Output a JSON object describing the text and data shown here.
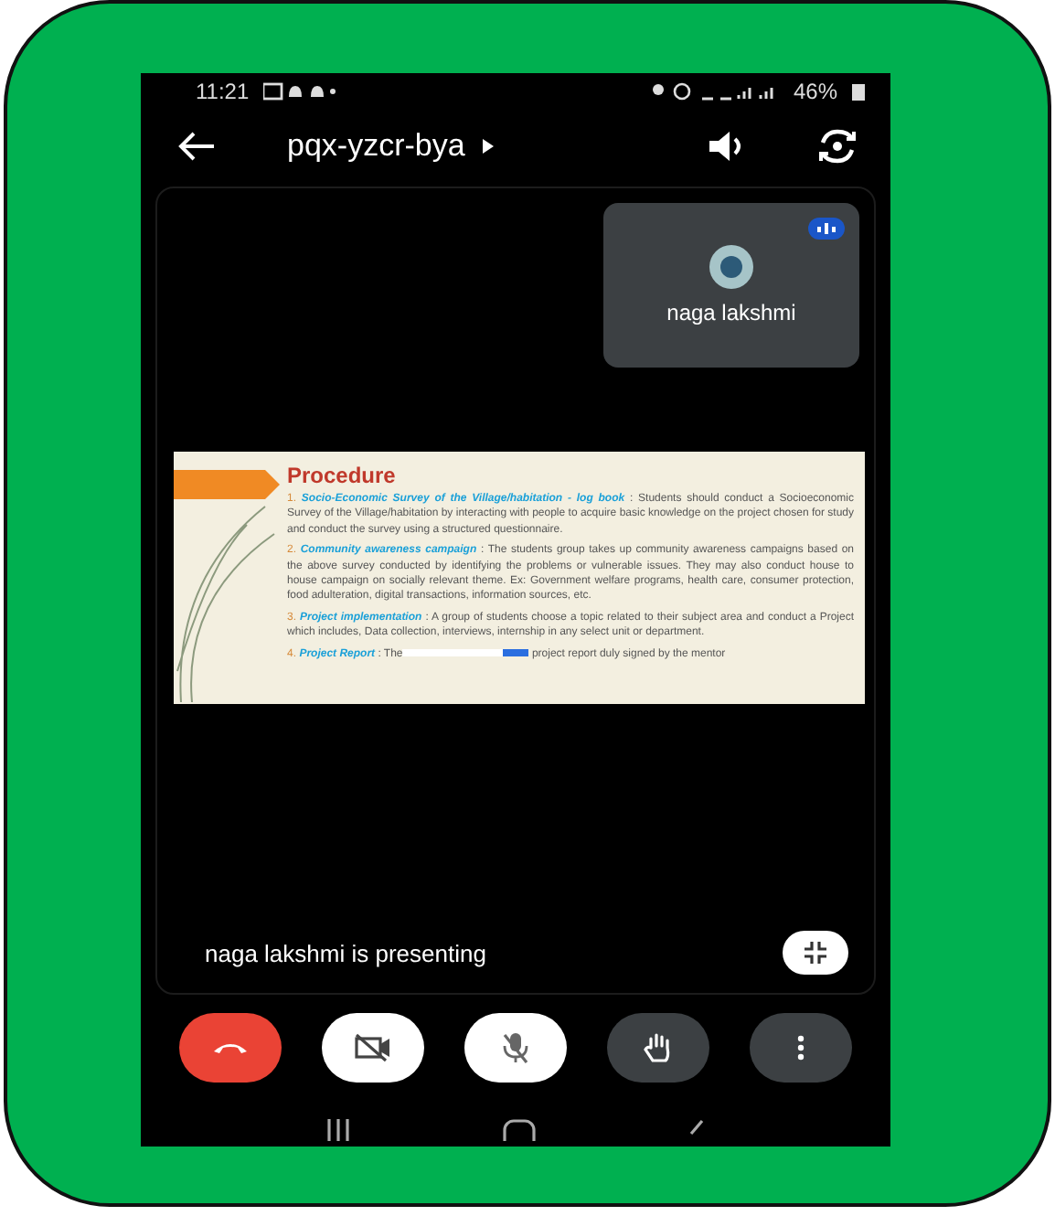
{
  "status_bar": {
    "time": "11:21",
    "battery": "46%"
  },
  "header": {
    "meeting_code": "pqx-yzcr-bya"
  },
  "participant_tile": {
    "name": "naga lakshmi",
    "speaking": true
  },
  "slide": {
    "title": "Procedure",
    "items": [
      {
        "number": "1.",
        "heading": "Socio-Economic Survey of the Village/habitation - log book",
        "text": ": Students should conduct a Socioeconomic Survey of the Village/habitation by interacting with people to acquire basic knowledge on the project chosen for study and conduct the survey using a structured questionnaire."
      },
      {
        "number": "2.",
        "heading": "Community awareness campaign",
        "text": ": The students group takes up community awareness campaigns based on the above survey conducted by identifying the problems or vulnerable issues. They may also conduct house to house campaign on socially relevant theme. Ex: Government welfare programs, health care, consumer protection, food adulteration, digital transactions, information sources, etc."
      },
      {
        "number": "3.",
        "heading": "Project implementation",
        "text": ": A group of students choose a topic related to their subject area and conduct a Project which includes, Data collection, interviews, internship in any select unit or department."
      },
      {
        "number": "4.",
        "heading": "Project Report",
        "text": ": The",
        "text_after": "project report duly signed by the mentor",
        "covered": true
      }
    ]
  },
  "presenting_text": "naga lakshmi is presenting",
  "controls": [
    {
      "kind": "hangup"
    },
    {
      "kind": "camera",
      "on": false
    },
    {
      "kind": "mic",
      "on": false
    },
    {
      "kind": "hand"
    },
    {
      "kind": "more"
    }
  ]
}
